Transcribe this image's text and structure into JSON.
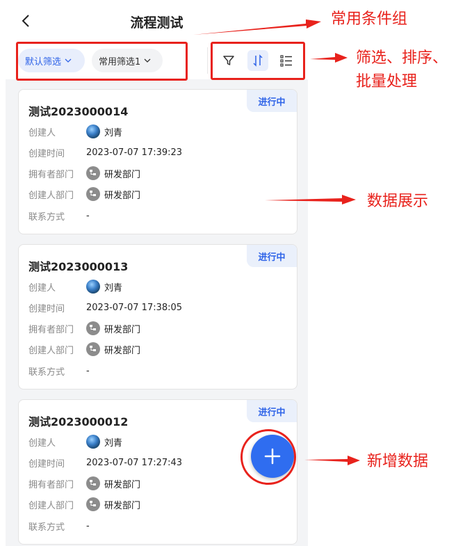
{
  "navbar": {
    "title": "流程测试",
    "back_icon": "chevron-left-icon"
  },
  "filters": {
    "chips": [
      {
        "label": "默认筛选",
        "active": true
      },
      {
        "label": "常用筛选1",
        "active": false
      }
    ],
    "tools": [
      "filter-funnel-icon",
      "sort-icon",
      "batch-list-icon"
    ]
  },
  "records": [
    {
      "title": "测试2023000014",
      "status": "进行中",
      "fields": [
        {
          "label": "创建人",
          "value": "刘青",
          "icon": "avatar"
        },
        {
          "label": "创建时间",
          "value": "2023-07-07 17:39:23"
        },
        {
          "label": "拥有者部门",
          "value": "研发部门",
          "icon": "department-icon"
        },
        {
          "label": "创建人部门",
          "value": "研发部门",
          "icon": "department-icon"
        },
        {
          "label": "联系方式",
          "value": "-"
        }
      ]
    },
    {
      "title": "测试2023000013",
      "status": "进行中",
      "fields": [
        {
          "label": "创建人",
          "value": "刘青",
          "icon": "avatar"
        },
        {
          "label": "创建时间",
          "value": "2023-07-07 17:38:05"
        },
        {
          "label": "拥有者部门",
          "value": "研发部门",
          "icon": "department-icon"
        },
        {
          "label": "创建人部门",
          "value": "研发部门",
          "icon": "department-icon"
        },
        {
          "label": "联系方式",
          "value": "-"
        }
      ]
    },
    {
      "title": "测试2023000012",
      "status": "进行中",
      "fields": [
        {
          "label": "创建人",
          "value": "刘青",
          "icon": "avatar"
        },
        {
          "label": "创建时间",
          "value": "2023-07-07 17:27:43"
        },
        {
          "label": "拥有者部门",
          "value": "研发部门",
          "icon": "department-icon"
        },
        {
          "label": "创建人部门",
          "value": "研发部门",
          "icon": "department-icon"
        },
        {
          "label": "联系方式",
          "value": "-"
        }
      ]
    }
  ],
  "fab": {
    "icon": "plus-icon"
  },
  "annotations": {
    "common_groups": "常用条件组",
    "filter_sort_batch_line1": "筛选、排序、",
    "filter_sort_batch_line2": "批量处理",
    "data_display": "数据展示",
    "add_data": "新增数据"
  },
  "colors": {
    "accent": "#2f64e8",
    "annotation": "#e8221c",
    "status_bg": "#eaf0fb"
  }
}
